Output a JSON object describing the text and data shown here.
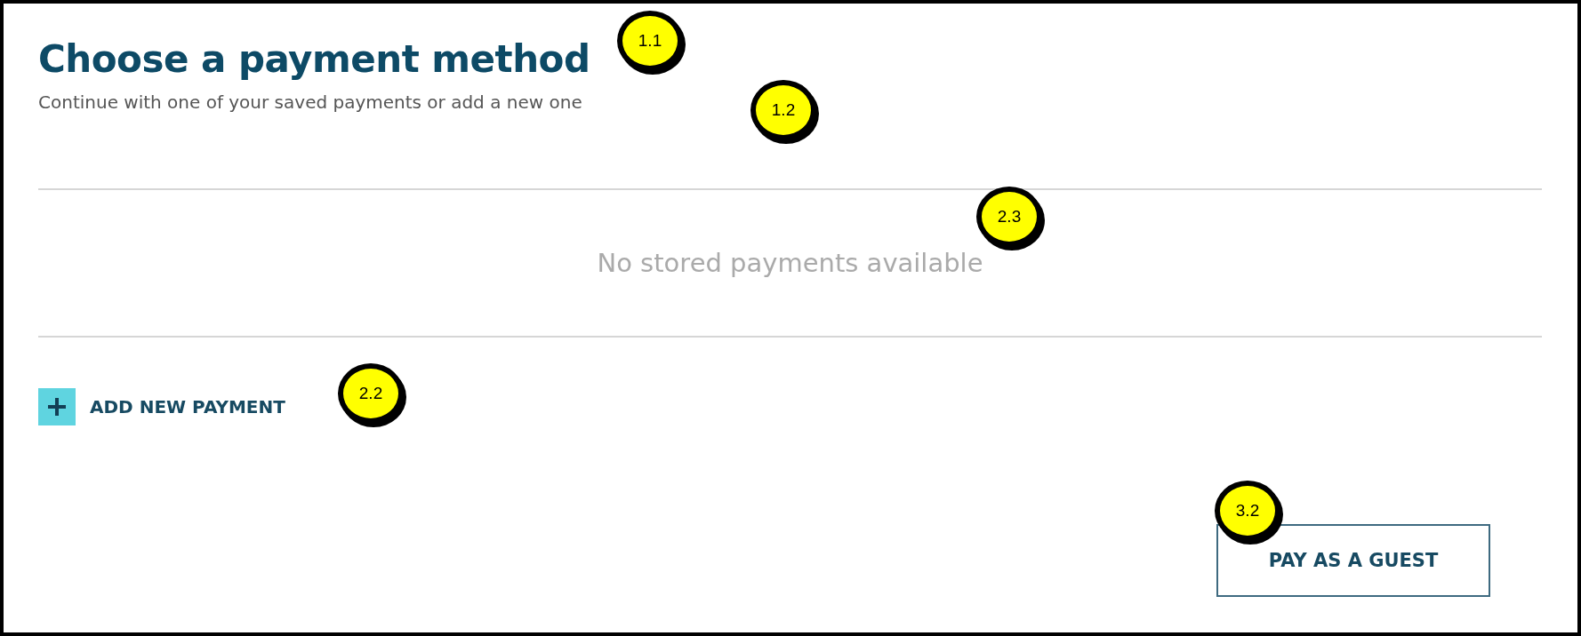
{
  "heading": "Choose a payment method",
  "subtitle": "Continue with one of your saved payments or add a new one",
  "empty_message": "No stored payments available",
  "add_payment": {
    "label": "ADD NEW PAYMENT"
  },
  "guest_button": {
    "label": "PAY AS A GUEST"
  },
  "callouts": [
    {
      "label": "1.1"
    },
    {
      "label": "1.2"
    },
    {
      "label": "2.3"
    },
    {
      "label": "2.2"
    },
    {
      "label": "3.2"
    }
  ]
}
